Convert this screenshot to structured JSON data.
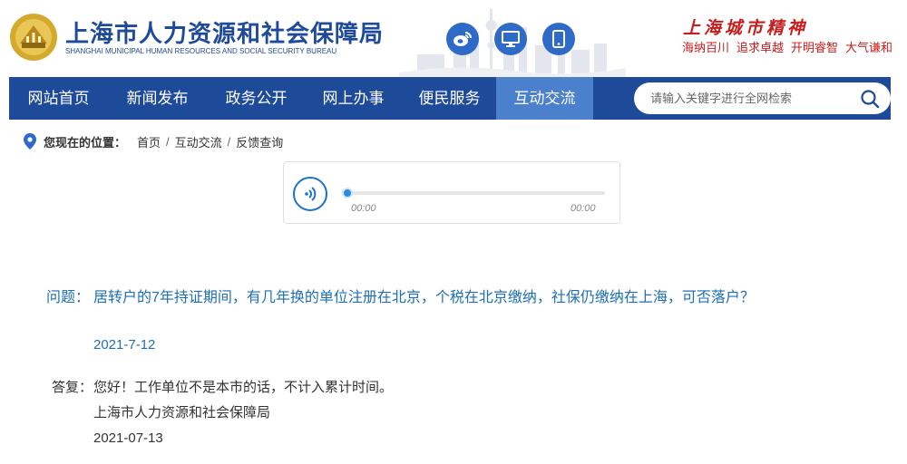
{
  "header": {
    "title": "上海市人力资源和社会保障局",
    "subtitle": "SHANGHAI MUNICIPAL HUMAN RESOURCES AND SOCIAL SECURITY BUREAU",
    "buttons": {
      "weibo": "weibo-icon",
      "pc": "desktop-icon",
      "mobile": "mobile-icon"
    },
    "spirit": {
      "title": "上海城市精神",
      "items": [
        "海纳百川",
        "追求卓越",
        "开明睿智",
        "大气谦和"
      ]
    }
  },
  "nav": {
    "items": [
      {
        "label": "网站首页"
      },
      {
        "label": "新闻发布"
      },
      {
        "label": "政务公开"
      },
      {
        "label": "网上办事"
      },
      {
        "label": "便民服务"
      },
      {
        "label": "互动交流",
        "active": true
      }
    ],
    "search_placeholder": "请输入关键字进行全网检索"
  },
  "breadcrumb": {
    "label": "您现在的位置：",
    "items": [
      "首页",
      "互动交流",
      "反馈查询"
    ],
    "separator": "/"
  },
  "player": {
    "current_time": "00:00",
    "total_time": "00:00",
    "progress": 0
  },
  "question": {
    "label": "问题：",
    "text": "居转户的7年持证期间，有几年换的单位注册在北京，个税在北京缴纳，社保仍缴纳在上海，可否落户？",
    "date": "2021-7-12"
  },
  "answer": {
    "label": "答复：",
    "text": "您好！工作单位不是本市的话，不计入累计时间。",
    "org": "上海市人力资源和社会保障局",
    "date": "2021-07-13"
  },
  "colors": {
    "nav_bg": "#1e4a9a",
    "nav_active": "#4a80cc",
    "question_text": "#1e6fb4",
    "spirit_red": "#c71c1c"
  }
}
